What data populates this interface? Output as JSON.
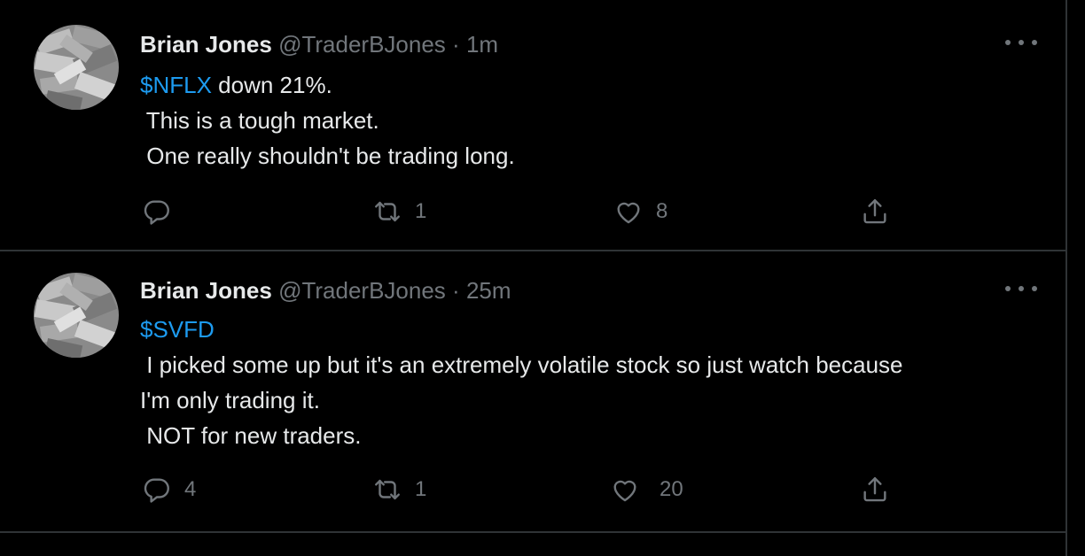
{
  "tweets": [
    {
      "name": "Brian Jones",
      "handle": "@TraderBJones",
      "separator": "·",
      "time": "1m",
      "cashtag": "$NFLX",
      "first_line_rest": " down 21%.",
      "lines": [
        " This is a tough market.",
        " One really shouldn't be trading long."
      ],
      "reply_count": "",
      "retweet_count": "1",
      "like_count": "8"
    },
    {
      "name": "Brian Jones",
      "handle": "@TraderBJones",
      "separator": "·",
      "time": "25m",
      "cashtag": "$SVFD",
      "first_line_rest": "",
      "lines": [
        " I picked some up but it's an extremely volatile stock so just watch because",
        "I'm only trading it.",
        " NOT for new traders."
      ],
      "reply_count": "4",
      "retweet_count": "1",
      "like_count": "20"
    }
  ],
  "icons": {
    "reply": "reply-icon",
    "retweet": "retweet-icon",
    "like": "heart-icon",
    "share": "share-icon",
    "more": "more-icon"
  },
  "colors": {
    "background": "#000000",
    "text": "#e7e9ea",
    "muted": "#71767b",
    "cashtag": "#1d9bf0",
    "border": "#2f3336"
  }
}
